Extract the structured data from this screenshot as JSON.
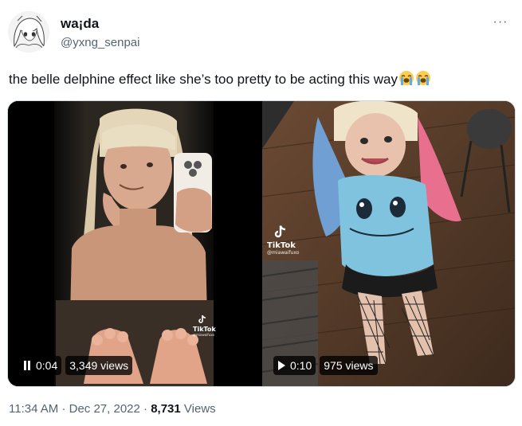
{
  "tweet": {
    "display_name": "wa¡da",
    "handle": "@yxng_senpai",
    "text": "the belle delphine effect like she’s too pretty to be acting this way",
    "more_label": "···"
  },
  "media": {
    "videos": [
      {
        "time": "0:04",
        "views": "3,349 views",
        "state": "playing",
        "tiktok_brand": "TikTok",
        "tiktok_user": "@miawaifuxo"
      },
      {
        "time": "0:10",
        "views": "975 views",
        "state": "paused",
        "tiktok_brand": "TikTok",
        "tiktok_user": "@miawaifuxo"
      }
    ]
  },
  "footer": {
    "time": "11:34 AM",
    "date": "Dec 27, 2022",
    "views_count": "8,731",
    "views_label": "Views"
  },
  "colors": {
    "text_primary": "#0f1419",
    "text_secondary": "#536471",
    "border": "#cfd9de",
    "accent": "#1d9bf0"
  },
  "icons": [
    "avatar",
    "more-icon",
    "loudly-crying-face-emoji",
    "pause-icon",
    "play-icon",
    "tiktok-logo-icon"
  ]
}
